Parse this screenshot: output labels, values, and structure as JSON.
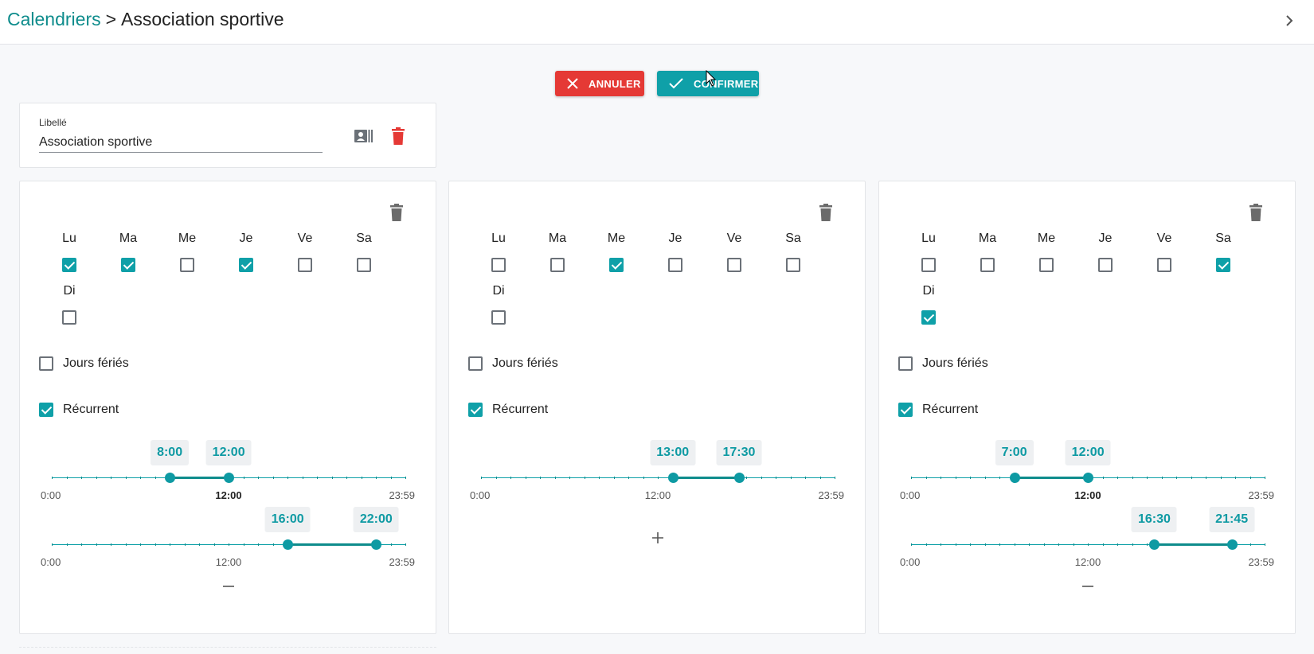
{
  "breadcrumb": {
    "parent": "Calendriers",
    "separator": ">",
    "current": "Association sportive"
  },
  "actions": {
    "cancel_label": "ANNULER",
    "confirm_label": "CONFIRMER"
  },
  "libelle": {
    "label": "Libellé",
    "value": "Association sportive"
  },
  "options": {
    "holidays_label": "Jours fériés",
    "recurrent_label": "Récurrent"
  },
  "axis": {
    "start": "0:00",
    "mid": "12:00",
    "end": "23:59"
  },
  "colors": {
    "accent": "#0fa0a8",
    "danger": "#e53935",
    "link": "#0e8c8c"
  },
  "cards": [
    {
      "days": [
        {
          "label": "Lu",
          "checked": true
        },
        {
          "label": "Ma",
          "checked": true
        },
        {
          "label": "Me",
          "checked": false
        },
        {
          "label": "Je",
          "checked": true
        },
        {
          "label": "Ve",
          "checked": false
        },
        {
          "label": "Sa",
          "checked": false
        },
        {
          "label": "Di",
          "checked": false
        }
      ],
      "holidays": false,
      "recurrent": true,
      "ranges": [
        {
          "start": "8:00",
          "end": "12:00",
          "start_min": 480,
          "end_min": 720
        },
        {
          "start": "16:00",
          "end": "22:00",
          "start_min": 960,
          "end_min": 1320
        }
      ],
      "footer_action": "remove"
    },
    {
      "days": [
        {
          "label": "Lu",
          "checked": false
        },
        {
          "label": "Ma",
          "checked": false
        },
        {
          "label": "Me",
          "checked": true
        },
        {
          "label": "Je",
          "checked": false
        },
        {
          "label": "Ve",
          "checked": false
        },
        {
          "label": "Sa",
          "checked": false
        },
        {
          "label": "Di",
          "checked": false
        }
      ],
      "holidays": false,
      "recurrent": true,
      "ranges": [
        {
          "start": "13:00",
          "end": "17:30",
          "start_min": 780,
          "end_min": 1050
        }
      ],
      "footer_action": "add"
    },
    {
      "days": [
        {
          "label": "Lu",
          "checked": false
        },
        {
          "label": "Ma",
          "checked": false
        },
        {
          "label": "Me",
          "checked": false
        },
        {
          "label": "Je",
          "checked": false
        },
        {
          "label": "Ve",
          "checked": false
        },
        {
          "label": "Sa",
          "checked": true
        },
        {
          "label": "Di",
          "checked": true
        }
      ],
      "holidays": false,
      "recurrent": true,
      "ranges": [
        {
          "start": "7:00",
          "end": "12:00",
          "start_min": 420,
          "end_min": 720
        },
        {
          "start": "16:30",
          "end": "21:45",
          "start_min": 990,
          "end_min": 1305
        }
      ],
      "footer_action": "remove"
    }
  ]
}
